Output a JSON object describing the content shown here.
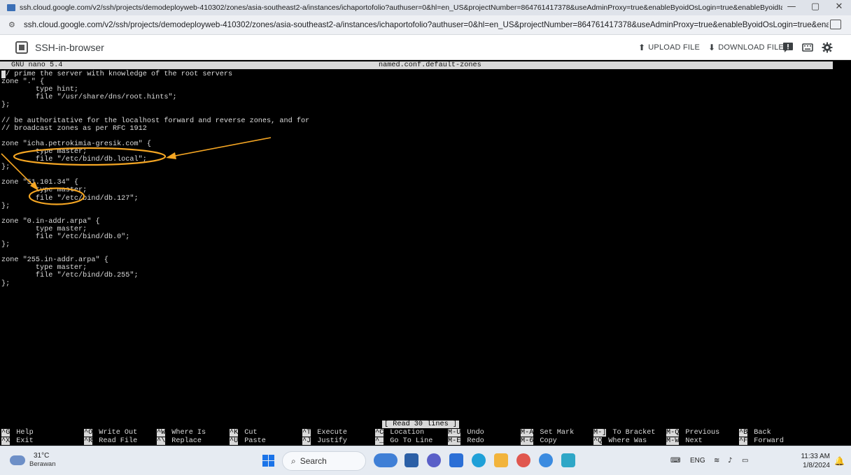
{
  "browser": {
    "window_title": "ssh.cloud.google.com/v2/ssh/projects/demodeployweb-410302/zones/asia-southeast2-a/instances/ichaportofolio?authuser=0&hl=en_US&projectNumber=864761417378&useAdminProxy=true&enableByoidOsLogin=true&enableByoidIap=true - Google Ch...",
    "url": "ssh.cloud.google.com/v2/ssh/projects/demodeployweb-410302/zones/asia-southeast2-a/instances/ichaportofolio?authuser=0&hl=en_US&projectNumber=864761417378&useAdminProxy=true&enableByoidOsLogin=true&enableBy...",
    "minimize": "—",
    "restore": "▢",
    "close": "✕"
  },
  "ssh_toolbar": {
    "app_name": "SSH-in-browser",
    "upload_label": "UPLOAD FILE",
    "download_label": "DOWNLOAD FILE",
    "upload_arrow": "⬆",
    "download_arrow": "⬇"
  },
  "editor": {
    "version": "GNU nano 5.4",
    "filename": "named.conf.default-zones",
    "lines": [
      "// prime the server with knowledge of the root servers",
      "zone \".\" {",
      "        type hint;",
      "        file \"/usr/share/dns/root.hints\";",
      "};",
      "",
      "// be authoritative for the localhost forward and reverse zones, and for",
      "// broadcast zones as per RFC 1912",
      "",
      "zone \"icha.petrokimia-gresik.com\" {",
      "        type master;",
      "        file \"/etc/bind/db.local\";",
      "};",
      "",
      "zone \"51.101.34\" {",
      "        type master;",
      "        file \"/etc/bind/db.127\";",
      "};",
      "",
      "zone \"0.in-addr.arpa\" {",
      "        type master;",
      "        file \"/etc/bind/db.0\";",
      "};",
      "",
      "zone \"255.in-addr.arpa\" {",
      "        type master;",
      "        file \"/etc/bind/db.255\";",
      "};"
    ],
    "status_message": "[ Read 30 lines ]",
    "shortcuts": [
      {
        "key": "^G",
        "label": "Help"
      },
      {
        "key": "^X",
        "label": "Exit"
      },
      {
        "key": "^O",
        "label": "Write Out"
      },
      {
        "key": "^R",
        "label": "Read File"
      },
      {
        "key": "^W",
        "label": "Where Is"
      },
      {
        "key": "^\\",
        "label": "Replace"
      },
      {
        "key": "^K",
        "label": "Cut"
      },
      {
        "key": "^U",
        "label": "Paste"
      },
      {
        "key": "^T",
        "label": "Execute"
      },
      {
        "key": "^J",
        "label": "Justify"
      },
      {
        "key": "^C",
        "label": "Location"
      },
      {
        "key": "^_",
        "label": "Go To Line"
      },
      {
        "key": "M-U",
        "label": "Undo"
      },
      {
        "key": "M-E",
        "label": "Redo"
      },
      {
        "key": "M-A",
        "label": "Set Mark"
      },
      {
        "key": "M-6",
        "label": "Copy"
      },
      {
        "key": "M-]",
        "label": "To Bracket"
      },
      {
        "key": "^Q",
        "label": "Where Was"
      },
      {
        "key": "M-Q",
        "label": "Previous"
      },
      {
        "key": "M-W",
        "label": "Next"
      },
      {
        "key": "^B",
        "label": "Back"
      },
      {
        "key": "^F",
        "label": "Forward"
      }
    ]
  },
  "annotation_color": "#f5a623",
  "taskbar": {
    "temperature": "31°C",
    "weather": "Berawan",
    "search_label": "Search",
    "language": "ENG",
    "time": "11:33 AM",
    "date": "1/8/2024"
  }
}
